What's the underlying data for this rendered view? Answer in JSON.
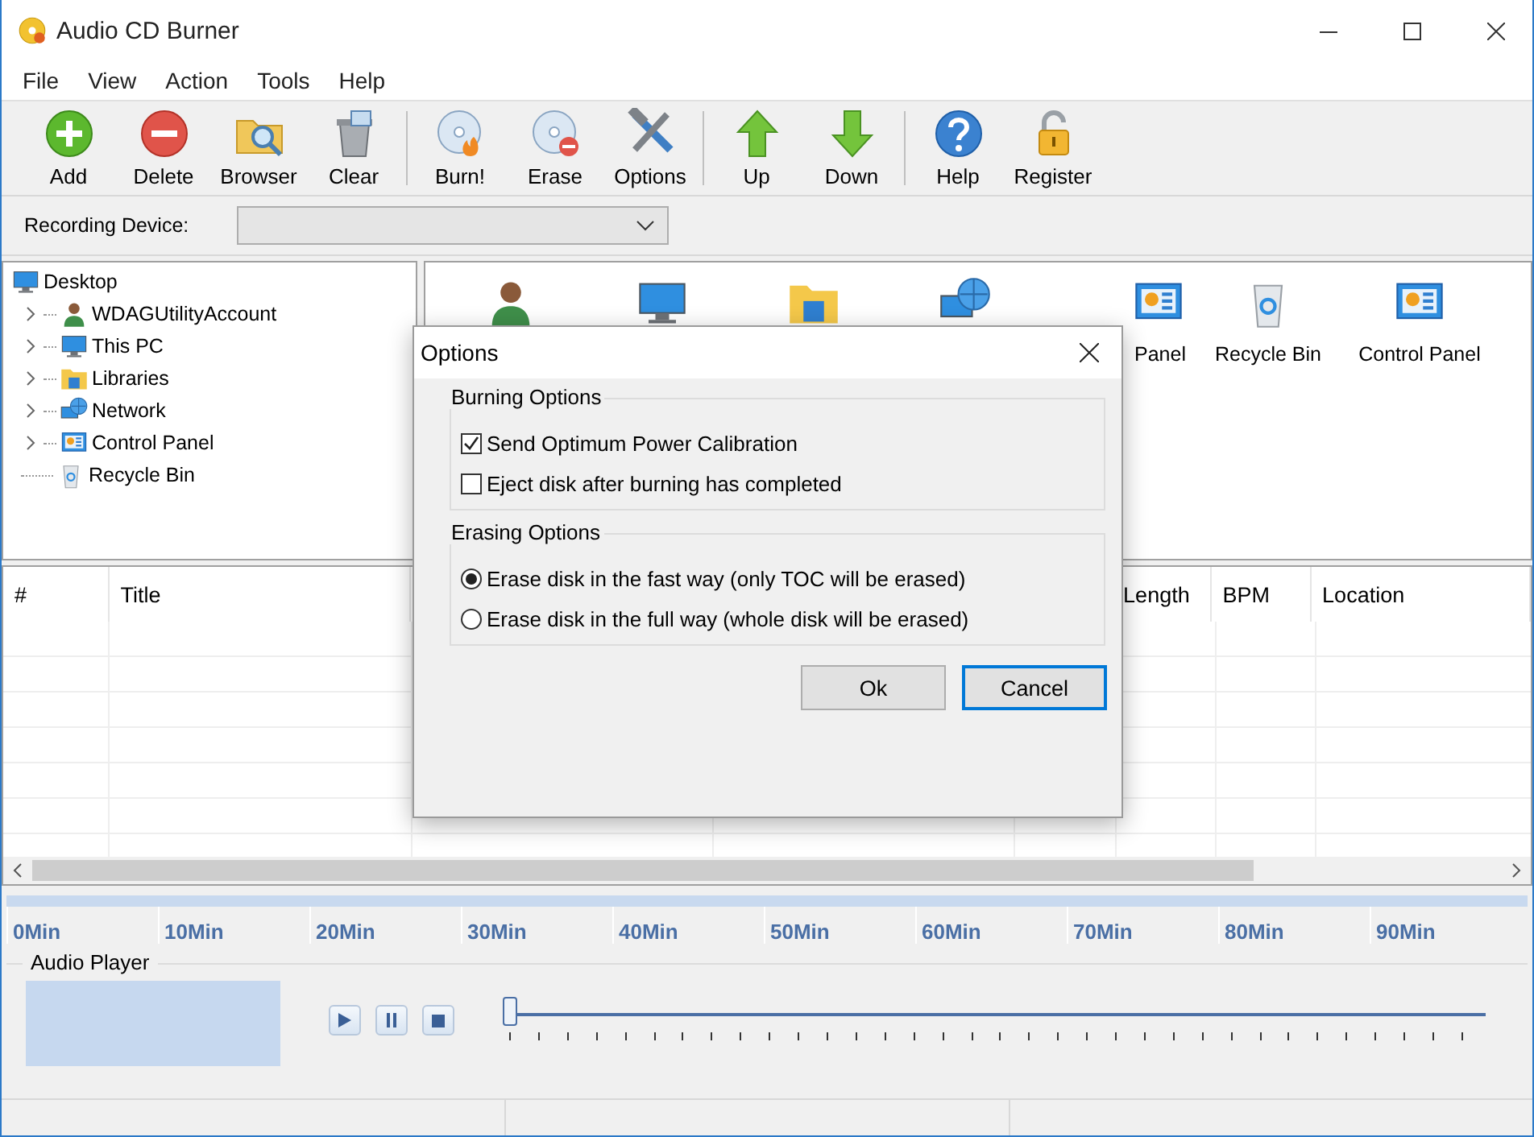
{
  "window": {
    "title": "Audio CD Burner"
  },
  "menu": [
    "File",
    "View",
    "Action",
    "Tools",
    "Help"
  ],
  "toolbar": [
    [
      {
        "label": "Add",
        "kind": "add"
      },
      {
        "label": "Delete",
        "kind": "delete"
      },
      {
        "label": "Browser",
        "kind": "browser"
      },
      {
        "label": "Clear",
        "kind": "clear"
      }
    ],
    [
      {
        "label": "Burn!",
        "kind": "burn"
      },
      {
        "label": "Erase",
        "kind": "erase"
      },
      {
        "label": "Options",
        "kind": "options"
      }
    ],
    [
      {
        "label": "Up",
        "kind": "up"
      },
      {
        "label": "Down",
        "kind": "down"
      }
    ],
    [
      {
        "label": "Help",
        "kind": "help"
      },
      {
        "label": "Register",
        "kind": "register"
      }
    ]
  ],
  "recording_device": {
    "label": "Recording Device:"
  },
  "tree": {
    "label": "Desktop",
    "kind": "desktop",
    "children": [
      {
        "label": "WDAGUtilityAccount",
        "kind": "user",
        "expanded": false
      },
      {
        "label": "This PC",
        "kind": "computer",
        "expanded": false
      },
      {
        "label": "Libraries",
        "kind": "folder",
        "expanded": false
      },
      {
        "label": "Network",
        "kind": "network",
        "expanded": false
      },
      {
        "label": "Control Panel",
        "kind": "panel",
        "expanded": false
      },
      {
        "label": "Recycle Bin",
        "kind": "bin"
      }
    ]
  },
  "file_view": {
    "items": [
      {
        "kind": "user"
      },
      {
        "kind": "computer"
      },
      {
        "kind": "folder"
      },
      {
        "kind": "network"
      },
      {
        "kind": "panel",
        "label": "Panel"
      },
      {
        "kind": "bin",
        "label": "Recycle Bin"
      },
      {
        "kind": "panel",
        "label": "Control Panel"
      }
    ]
  },
  "track_table": {
    "columns": [
      "#",
      "Title",
      "Length",
      "BPM",
      "Location"
    ]
  },
  "timeline": [
    "0Min",
    "10Min",
    "20Min",
    "30Min",
    "40Min",
    "50Min",
    "60Min",
    "70Min",
    "80Min",
    "90Min"
  ],
  "audio_player": {
    "title": "Audio Player",
    "level": 0
  },
  "dialog": {
    "title": "Options",
    "groups": [
      {
        "title": "Burning Options",
        "options": [
          {
            "kind": "checkbox",
            "label": "Send Optimum Power Calibration",
            "checked": true
          },
          {
            "kind": "checkbox",
            "label": "Eject disk after burning has completed",
            "checked": false
          }
        ]
      },
      {
        "title": "Erasing Options",
        "options": [
          {
            "kind": "radio",
            "label": "Erase disk in the fast way (only TOC will be erased)",
            "selected": true
          },
          {
            "kind": "radio",
            "label": "Erase disk in the full way (whole disk will be erased)",
            "selected": false
          }
        ]
      }
    ],
    "buttons": [
      {
        "label": "Ok",
        "focused": false
      },
      {
        "label": "Cancel",
        "focused": true
      }
    ]
  }
}
